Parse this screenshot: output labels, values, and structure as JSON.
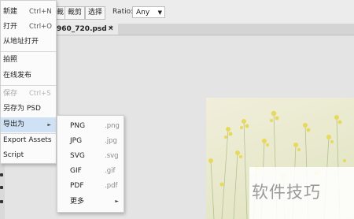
{
  "toolbar": {
    "btn_partial": "裁",
    "crop_label": "裁剪",
    "select_label": "选择",
    "ratio_label": "Ratio:",
    "ratio_value": "Any"
  },
  "document_tab": {
    "title": "960_720.psd *",
    "close_glyph": "✕"
  },
  "file_menu": {
    "items": [
      {
        "label": "新建",
        "shortcut": "Ctrl+N"
      },
      {
        "label": "打开",
        "shortcut": "Ctrl+O"
      },
      {
        "label": "从地址打开",
        "shortcut": ""
      },
      {
        "label": "拍照",
        "shortcut": ""
      },
      {
        "label": "在线发布",
        "shortcut": ""
      },
      {
        "label": "保存",
        "shortcut": "Ctrl+S",
        "disabled": true
      },
      {
        "label": "另存为 PSD",
        "shortcut": ""
      },
      {
        "label": "导出为",
        "shortcut": "",
        "submenu": true
      },
      {
        "label": "Export Assets",
        "shortcut": ""
      },
      {
        "label": "Script",
        "shortcut": ""
      }
    ]
  },
  "export_menu": {
    "items": [
      {
        "label": "PNG",
        "ext": ".png"
      },
      {
        "label": "JPG",
        "ext": ".jpg"
      },
      {
        "label": "SVG",
        "ext": ".svg"
      },
      {
        "label": "GIF",
        "ext": ".gif"
      },
      {
        "label": "PDF",
        "ext": ".pdf"
      },
      {
        "label": "更多",
        "ext": ""
      }
    ]
  },
  "watermark": "软件技巧",
  "icons": {
    "submenu_arrow": "►",
    "dropdown_arrow": "▼"
  }
}
